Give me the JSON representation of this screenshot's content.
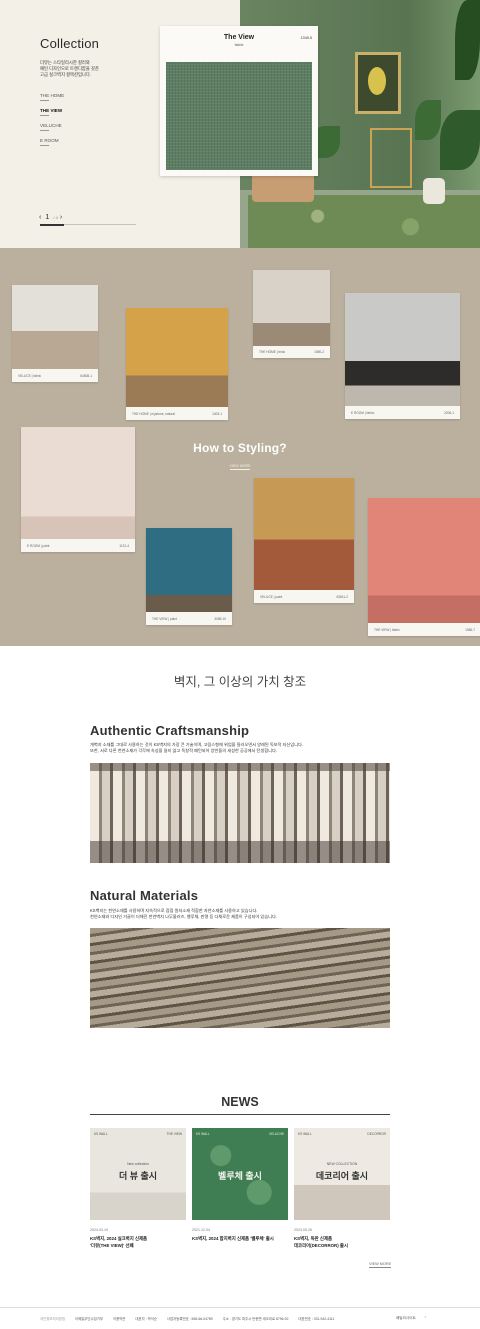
{
  "hero": {
    "title": "Collection",
    "description": [
      "더뷰는 스타일리시한 컬러와",
      "패턴 디자인으로 트렌디함을 갖춘",
      "고급 실크벽지 컬렉션입니다."
    ],
    "menu": [
      "THE HOME",
      "THE VIEW",
      "VELUCHE",
      "E ROOM"
    ],
    "active_menu": "THE VIEW",
    "pager": {
      "prev": "‹",
      "current": "1",
      "total": "/ 4",
      "next": "›"
    },
    "progress_fraction": 0.25,
    "card": {
      "name": "The View",
      "type": "fabric",
      "code": "1049-5"
    },
    "colors": {
      "swatch": "#5e7e63",
      "background": "#f3f0e7"
    }
  },
  "styling": {
    "title": "How to Styling?",
    "more": "VIEW MORE",
    "background": "#bbb09e",
    "photos": [
      {
        "caption": "VELUCE  |  fabric",
        "code": "64808-1"
      },
      {
        "caption": "THE HOME  |  mystone, natural",
        "code": "1403-1"
      },
      {
        "caption": "THE HOME  |  brick",
        "code": "1080-2"
      },
      {
        "caption": "E ROOM  |  fabric",
        "code": "2206-1"
      },
      {
        "caption": "E ROOM  |  paint",
        "code": "1121-4"
      },
      {
        "caption": "THE VIEW  |  paint",
        "code": "3085-10"
      },
      {
        "caption": "VELUCE  |  paint",
        "code": "63611-2"
      },
      {
        "caption": "THE VIEW  |  fabric",
        "code": "1086-7"
      }
    ]
  },
  "value": {
    "title": "벽지, 그 이상의 가치 창조",
    "craft": {
      "title": "Authentic Craftsmanship",
      "desc": [
        "개벽지 소재를 그대로 사용하는 것이 KS벽지의 가장 큰 기술이며, 고림스형에 위업을 질러오면서 양래된 독보적 자신입니다.",
        "또한, 서로 다른 천연소재가 각각에 속성을 잃지 않고 독창적 패턴되어 앙반들의 새성한 공공에서 탄생합니다."
      ]
    },
    "natural": {
      "title": "Natural Materials",
      "desc": [
        "KS벽지는 천연소재를 사용하며 지속적으로 점점 원자소재 적합한 자연소재를 사용하고 있습니다.",
        "천연소재와 디자인 거골이 더해진 천연벽지 나무울러즈, 벨루체, 판명 등 다채로운 제품이 구성되어 있습니다."
      ]
    }
  },
  "news": {
    "title": "NEWS",
    "view_more": "VIEW MORE",
    "items": [
      {
        "brand": "KS WALL",
        "brand2": "THE VIEW",
        "over": "New collection",
        "big": "더 뷰 출시",
        "date": "2024.03.19",
        "headline": [
          "KS벽지, 2024 실크벽지 신제품",
          "'더뷰(THE VIEW)' 선봬"
        ]
      },
      {
        "brand": "KS WALL",
        "brand2": "VELUCHE",
        "over": "",
        "big": "벨루체 출시",
        "date": "2021.12.04",
        "headline": [
          "KS벽지, 2024 합지벽지 신제품 '벨루체' 출시"
        ]
      },
      {
        "brand": "KS WALL",
        "brand2": "DECORROR",
        "over": "NEW COLLECTION",
        "big": "데코리어 출시",
        "date": "2023.05.26",
        "headline": [
          "KS벽지, 독판 신제품",
          "데코리어(DECORROR) 출시"
        ]
      }
    ]
  },
  "footer": {
    "links": [
      "개인정보처리방침",
      "이메일무단수집거부",
      "이용약관",
      "대표자 : 박석순",
      "사업자등록번호 : 565-66-04789",
      "주소 : 경기도 파주시 탄현면 새오리로 8796-92",
      "대표번호 : 031-942-4111"
    ],
    "family_site": "패밀리사이트",
    "family_chevron": "⌃"
  }
}
